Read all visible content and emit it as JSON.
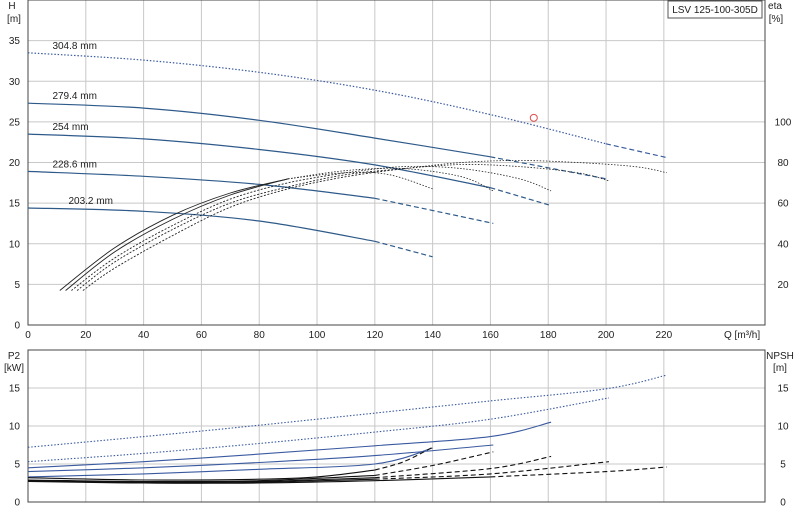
{
  "model_label": "LSV 125-100-305D",
  "chart_data": [
    {
      "type": "line",
      "panel": "head-efficiency",
      "y_left_label": [
        "H",
        "[m]"
      ],
      "y_right_label": [
        "eta",
        "[%]"
      ],
      "x_label": "Q [m³/h]",
      "xlim": [
        0,
        255
      ],
      "ylim_left": [
        0,
        40
      ],
      "ylim_right": [
        0,
        160
      ],
      "x_ticks": [
        0,
        20,
        40,
        60,
        80,
        100,
        120,
        140,
        160,
        180,
        200,
        220
      ],
      "y_left_ticks": [
        0,
        5,
        10,
        15,
        20,
        25,
        30,
        35
      ],
      "y_right_ticks": [
        20,
        40,
        60,
        80,
        100
      ],
      "grid": true,
      "head_series": [
        {
          "name": "304.8 mm",
          "color": "#3a5aa0",
          "style": "dotted",
          "x": [
            0,
            40,
            80,
            120,
            160,
            200,
            221
          ],
          "y": [
            33.5,
            32.6,
            31.1,
            28.9,
            25.9,
            22.3,
            20.6
          ]
        },
        {
          "name": "279.4 mm",
          "color": "#2e5a8a",
          "style": "solid",
          "x": [
            0,
            40,
            80,
            120,
            160,
            200
          ],
          "y": [
            27.3,
            26.7,
            25.2,
            23.0,
            20.7,
            18.0
          ]
        },
        {
          "name": "254 mm",
          "color": "#2e5a8a",
          "style": "solid",
          "x": [
            0,
            40,
            80,
            120,
            160,
            181
          ],
          "y": [
            23.5,
            22.9,
            21.6,
            19.7,
            16.9,
            14.7
          ]
        },
        {
          "name": "228.6 mm",
          "color": "#2e5a8a",
          "style": "solid",
          "x": [
            0,
            40,
            80,
            120,
            161
          ],
          "y": [
            18.9,
            18.3,
            17.3,
            15.6,
            12.5
          ]
        },
        {
          "name": "203.2 mm",
          "color": "#2e5a8a",
          "style": "solid",
          "x": [
            0,
            40,
            80,
            120,
            140
          ],
          "y": [
            14.4,
            14.0,
            12.8,
            10.3,
            8.4
          ]
        }
      ],
      "efficiency_series": [
        {
          "x": [
            11,
            30,
            50,
            70,
            90,
            110,
            125,
            140
          ],
          "y": [
            17,
            38,
            54,
            65,
            72,
            75,
            74,
            67
          ]
        },
        {
          "x": [
            13,
            30,
            50,
            70,
            90,
            110,
            130,
            150,
            161
          ],
          "y": [
            17,
            36,
            52,
            64,
            72,
            76,
            77,
            73,
            66
          ]
        },
        {
          "x": [
            15,
            30,
            50,
            70,
            90,
            110,
            130,
            150,
            170,
            181
          ],
          "y": [
            17,
            33,
            49,
            62,
            70,
            75,
            78,
            77,
            72,
            66
          ]
        },
        {
          "x": [
            17,
            30,
            50,
            70,
            90,
            110,
            130,
            150,
            170,
            190,
            201
          ],
          "y": [
            17,
            31,
            47,
            60,
            68,
            74,
            77,
            79,
            78,
            75,
            71
          ]
        },
        {
          "x": [
            19,
            30,
            50,
            70,
            90,
            110,
            130,
            150,
            170,
            190,
            210,
            221
          ],
          "y": [
            17,
            28,
            44,
            58,
            67,
            73,
            77,
            80,
            81,
            80,
            78,
            75
          ]
        }
      ],
      "duty_point": {
        "x": 175,
        "y": 25.5
      }
    },
    {
      "type": "line",
      "panel": "power-npsh",
      "y_left_label": [
        "P2",
        "[kW]"
      ],
      "y_right_label": [
        "NPSH",
        "[m]"
      ],
      "xlim": [
        0,
        255
      ],
      "ylim": [
        0,
        20
      ],
      "y_ticks": [
        0,
        5,
        10,
        15
      ],
      "y_right_ticks": [
        0,
        5,
        10,
        15
      ],
      "grid": true,
      "power_series": [
        {
          "color": "#3a5aa0",
          "style": "dotted",
          "x": [
            0,
            40,
            80,
            120,
            160,
            200,
            221
          ],
          "y": [
            7.2,
            8.6,
            10.1,
            11.7,
            13.3,
            14.9,
            16.7
          ]
        },
        {
          "color": "#3a5aa0",
          "style": "dotted",
          "x": [
            0,
            40,
            80,
            120,
            160,
            201
          ],
          "y": [
            5.3,
            6.4,
            7.7,
            9.2,
            10.9,
            13.7
          ]
        },
        {
          "color": "#3a5aa0",
          "style": "solid",
          "x": [
            0,
            40,
            80,
            120,
            160,
            181
          ],
          "y": [
            4.5,
            5.3,
            6.3,
            7.4,
            8.6,
            10.5
          ]
        },
        {
          "color": "#3a5aa0",
          "style": "solid",
          "x": [
            0,
            40,
            80,
            120,
            161
          ],
          "y": [
            4.0,
            4.5,
            5.2,
            6.1,
            7.5
          ]
        },
        {
          "color": "#3a5aa0",
          "style": "solid",
          "x": [
            0,
            40,
            80,
            120,
            140
          ],
          "y": [
            3.3,
            3.7,
            4.3,
            5.0,
            7.1
          ]
        }
      ],
      "npsh_series": [
        {
          "x": [
            0,
            40,
            80,
            100,
            120,
            130,
            140
          ],
          "y": [
            3.2,
            2.9,
            3.0,
            3.3,
            4.2,
            5.3,
            7.2
          ]
        },
        {
          "x": [
            0,
            40,
            80,
            120,
            140,
            161
          ],
          "y": [
            2.9,
            2.7,
            2.8,
            3.5,
            4.8,
            6.6
          ]
        },
        {
          "x": [
            0,
            40,
            80,
            120,
            160,
            181
          ],
          "y": [
            2.8,
            2.6,
            2.7,
            3.2,
            4.4,
            6.0
          ]
        },
        {
          "x": [
            0,
            40,
            80,
            120,
            160,
            201
          ],
          "y": [
            2.8,
            2.5,
            2.6,
            3.0,
            3.7,
            5.3
          ]
        },
        {
          "x": [
            0,
            40,
            80,
            120,
            160,
            200,
            221
          ],
          "y": [
            2.7,
            2.5,
            2.5,
            2.8,
            3.3,
            4.0,
            4.6
          ]
        }
      ]
    }
  ]
}
